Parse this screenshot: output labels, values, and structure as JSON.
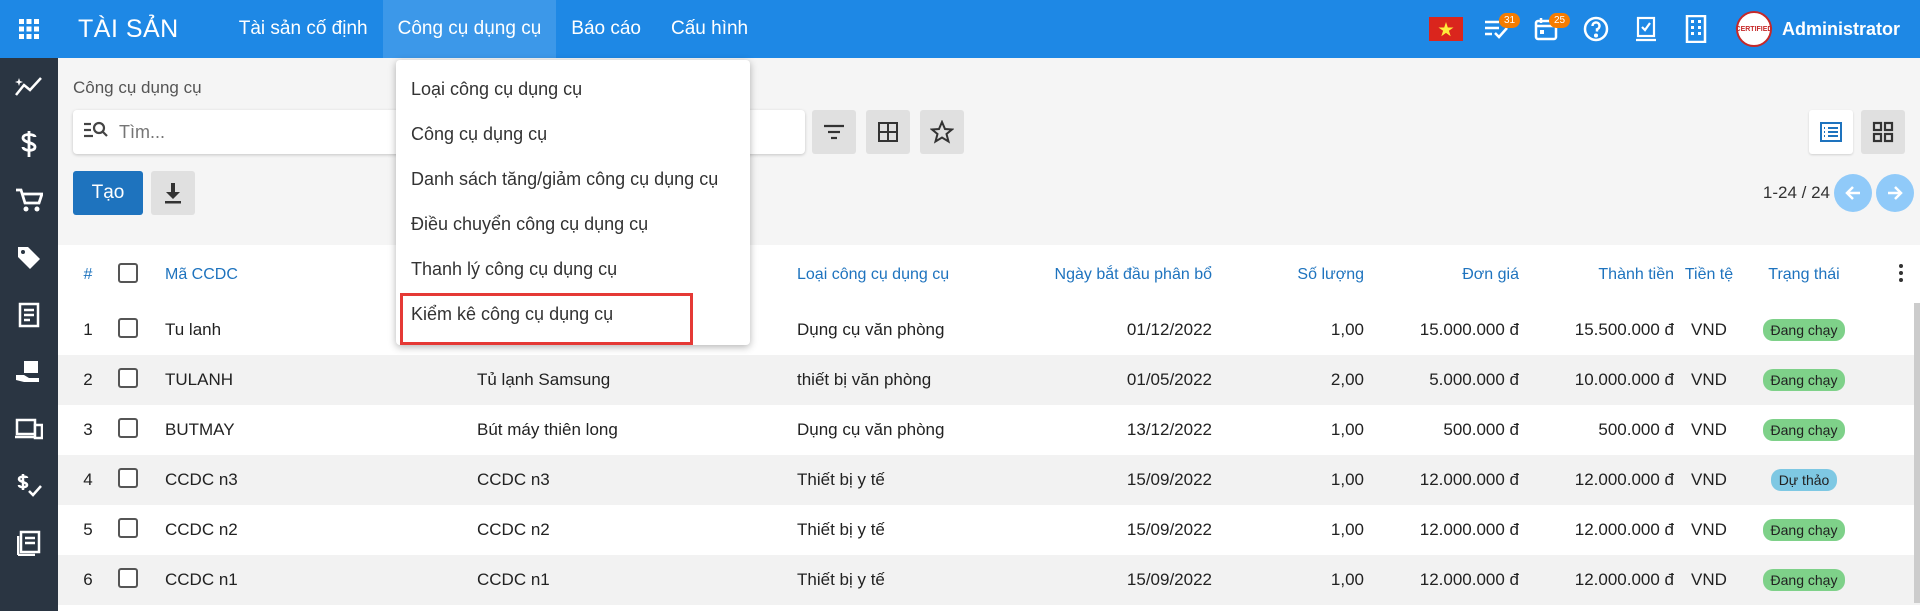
{
  "brand": "TÀI SẢN",
  "nav": [
    {
      "label": "Tài sản cố định",
      "active": false
    },
    {
      "label": "Công cụ dụng cụ",
      "active": true
    },
    {
      "label": "Báo cáo",
      "active": false
    },
    {
      "label": "Cấu hình",
      "active": false
    }
  ],
  "topbar": {
    "messages_badge": "31",
    "activities_badge": "25",
    "user_name": "Administrator",
    "avatar_text": "CERTIFIED"
  },
  "breadcrumb": "Công cụ dụng cụ",
  "search": {
    "placeholder": "Tìm..."
  },
  "buttons": {
    "create": "Tạo"
  },
  "pager": "1-24 / 24",
  "table": {
    "headers": {
      "index": "#",
      "code": "Mã CCDC",
      "type": "Loại công cụ dụng cụ",
      "start_date": "Ngày bắt đầu phân bổ",
      "quantity": "Số lượng",
      "unit_price": "Đơn giá",
      "total": "Thành tiền",
      "currency": "Tiền tệ",
      "status": "Trạng thái"
    },
    "rows": [
      {
        "index": "1",
        "code": "Tu lanh",
        "name": "",
        "type": "Dụng cụ văn phòng",
        "date": "01/12/2022",
        "qty": "1,00",
        "price": "15.000.000 đ",
        "total": "15.500.000 đ",
        "currency": "VND",
        "status": "Đang chạy"
      },
      {
        "index": "2",
        "code": "TULANH",
        "name": "Tủ lạnh Samsung",
        "type": "thiết bị văn phòng",
        "date": "01/05/2022",
        "qty": "2,00",
        "price": "5.000.000 đ",
        "total": "10.000.000 đ",
        "currency": "VND",
        "status": "Đang chạy"
      },
      {
        "index": "3",
        "code": "BUTMAY",
        "name": "Bút máy thiên long",
        "type": "Dụng cụ văn phòng",
        "date": "13/12/2022",
        "qty": "1,00",
        "price": "500.000 đ",
        "total": "500.000 đ",
        "currency": "VND",
        "status": "Đang chạy"
      },
      {
        "index": "4",
        "code": "CCDC n3",
        "name": "CCDC n3",
        "type": "Thiết bị y tế",
        "date": "15/09/2022",
        "qty": "1,00",
        "price": "12.000.000 đ",
        "total": "12.000.000 đ",
        "currency": "VND",
        "status": "Dự thảo"
      },
      {
        "index": "5",
        "code": "CCDC n2",
        "name": "CCDC n2",
        "type": "Thiết bị y tế",
        "date": "15/09/2022",
        "qty": "1,00",
        "price": "12.000.000 đ",
        "total": "12.000.000 đ",
        "currency": "VND",
        "status": "Đang chạy"
      },
      {
        "index": "6",
        "code": "CCDC n1",
        "name": "CCDC n1",
        "type": "Thiết bị y tế",
        "date": "15/09/2022",
        "qty": "1,00",
        "price": "12.000.000 đ",
        "total": "12.000.000 đ",
        "currency": "VND",
        "status": "Đang chạy"
      }
    ]
  },
  "dropdown": [
    "Loại công cụ dụng cụ",
    "Công cụ dụng cụ",
    "Danh sách tăng/giảm công cụ dụng cụ",
    "Điều chuyển công cụ dụng cụ",
    "Thanh lý công cụ dụng cụ",
    "Kiểm kê công cụ dụng cụ"
  ],
  "colors": {
    "primary": "#1e88e5",
    "sidebar": "#2a3542",
    "running": "#7ed189",
    "draft": "#7ec8e3",
    "highlight": "#e53935"
  }
}
